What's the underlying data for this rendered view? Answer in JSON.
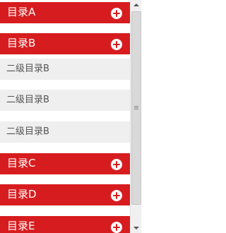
{
  "menu": {
    "accent_color": "#d71c1f",
    "sub_background": "#efefef",
    "headers": [
      {
        "label": "目录A",
        "icon": "plus-circle-icon"
      },
      {
        "label": "目录B",
        "icon": "plus-circle-icon"
      },
      {
        "label": "目录C",
        "icon": "plus-circle-icon"
      },
      {
        "label": "目录D",
        "icon": "plus-circle-icon"
      },
      {
        "label": "目录E",
        "icon": "plus-circle-icon"
      }
    ],
    "sub_items": [
      {
        "label": "二级目录B"
      },
      {
        "label": "二级目录B"
      },
      {
        "label": "二级目录B"
      }
    ]
  },
  "scrollbar": {
    "icons": [
      "scroll-up-arrow-icon",
      "scroll-down-arrow-icon",
      "scroll-thumb-grip-icon"
    ]
  }
}
